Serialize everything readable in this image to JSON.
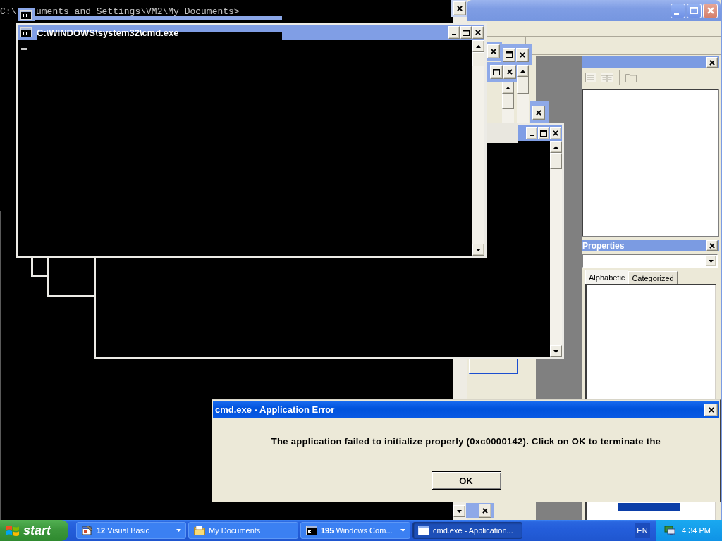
{
  "desktop": {
    "prompt_fragments": [
      "C:\\",
      "uments and Settings\\VM2\\My Documents>"
    ]
  },
  "console_window": {
    "title": "C:\\WINDOWS\\system32\\cmd.exe"
  },
  "ide_window": {
    "properties_panel": {
      "title": "Properties",
      "tabs": [
        {
          "label": "Alphabetic",
          "selected": true
        },
        {
          "label": "Categorized",
          "selected": false
        }
      ]
    }
  },
  "error_dialog": {
    "title": "cmd.exe - Application Error",
    "message": "The application failed to initialize properly (0xc0000142). Click on OK to terminate the",
    "buttons": [
      "OK"
    ]
  },
  "taskbar": {
    "start_button": "start",
    "tasks": [
      {
        "count": "12",
        "label": "Visual Basic",
        "grouped": true,
        "selected": false
      },
      {
        "label": "My Documents",
        "grouped": false,
        "selected": false
      },
      {
        "count": "195",
        "label": "Windows Com...",
        "grouped": true,
        "selected": false
      },
      {
        "label": "cmd.exe - Application...",
        "grouped": false,
        "selected": true
      }
    ],
    "language": "EN",
    "clock": "4:34 PM"
  }
}
